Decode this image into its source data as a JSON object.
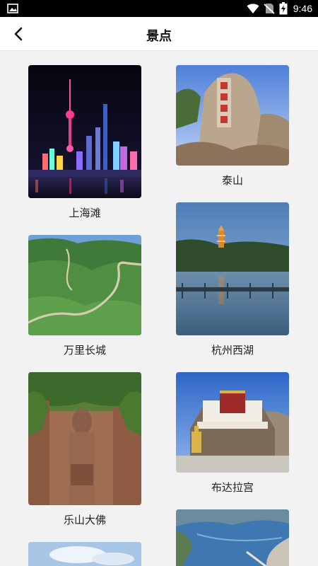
{
  "status_bar": {
    "time": "9:46",
    "icons": [
      "image-icon",
      "wifi-icon",
      "no-sim-icon",
      "battery-charging-icon"
    ]
  },
  "header": {
    "back_icon": "chevron-left-icon",
    "title": "景点"
  },
  "attractions": [
    {
      "name": "上海滩",
      "icon": "shanghai-bund-image"
    },
    {
      "name": "泰山",
      "icon": "mount-tai-image"
    },
    {
      "name": "万里长城",
      "icon": "great-wall-image"
    },
    {
      "name": "杭州西湖",
      "icon": "west-lake-image"
    },
    {
      "name": "乐山大佛",
      "icon": "leshan-buddha-image"
    },
    {
      "name": "布达拉宫",
      "icon": "potala-palace-image"
    }
  ]
}
